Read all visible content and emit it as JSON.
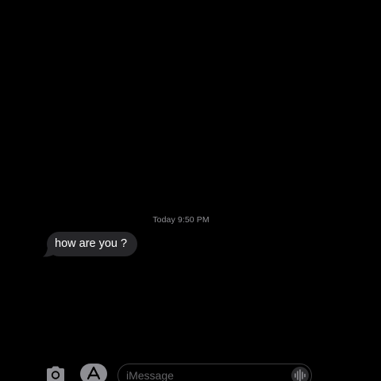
{
  "conversation": {
    "timestamp_day": "Today",
    "timestamp_time": "9:50 PM",
    "messages": [
      {
        "direction": "incoming",
        "text": "how are you ?"
      }
    ]
  },
  "composer": {
    "placeholder": "iMessage",
    "value": ""
  },
  "icons": {
    "camera": "camera-icon",
    "apps": "app-store-icon",
    "audio": "waveform-icon"
  },
  "colors": {
    "background": "#000000",
    "incoming_bubble": "#262629",
    "timestamp": "#8e8e93",
    "placeholder": "#636366"
  }
}
